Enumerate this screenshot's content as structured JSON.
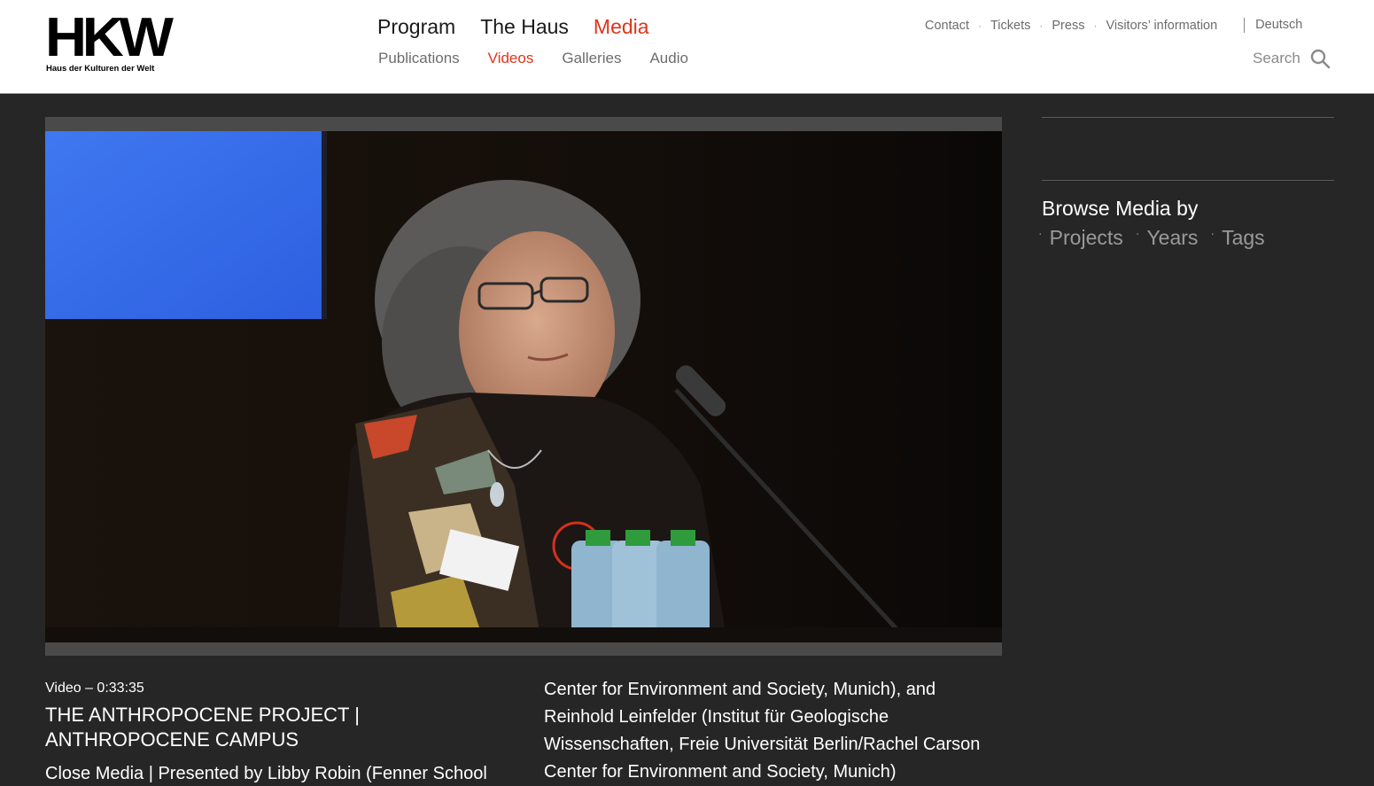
{
  "logo": {
    "wordmark": "HKW",
    "subtitle": "Haus der Kulturen der Welt"
  },
  "main_nav": [
    "Program",
    "The Haus",
    "Media"
  ],
  "main_nav_active": "Media",
  "sub_nav": [
    "Publications",
    "Videos",
    "Galleries",
    "Audio"
  ],
  "sub_nav_active": "Videos",
  "utility_nav": {
    "contact": "Contact",
    "tickets": "Tickets",
    "press": "Press",
    "visitors": "Visitors’ information",
    "separator": "·",
    "language": "Deutsch"
  },
  "search": {
    "label": "Search",
    "icon": "search-icon"
  },
  "sidebar": {
    "browse_title": "Browse Media by",
    "bullet": "·",
    "links": [
      "Projects",
      "Years",
      "Tags"
    ]
  },
  "video": {
    "meta": "Video – 0:33:35",
    "title": "THE ANTHROPOCENE PROJECT | ANTHROPOCENE CAMPUS",
    "subtitle_partial": "Close Media | Presented by Libby Robin (Fenner School",
    "description": "Center for Environment and Society, Munich), and Reinhold Leinfelder (Institut für Geologische Wissenschaften, Freie Universität Berlin/Rachel Carson Center for Environment and Society, Munich)"
  },
  "colors": {
    "accent": "#e0341a",
    "page_background": "#262626",
    "header_background": "#ffffff"
  }
}
